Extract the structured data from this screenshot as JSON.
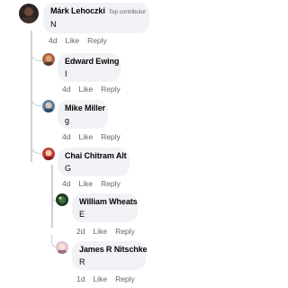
{
  "comments": [
    {
      "author": "Márk Lehoczki",
      "badge": "Top contributor",
      "text": "N",
      "time": "4d",
      "like": "Like",
      "reply": "Reply"
    },
    {
      "author": "Edward Ewing",
      "text": "I",
      "time": "4d",
      "like": "Like",
      "reply": "Reply"
    },
    {
      "author": "Mike Miller",
      "text": "g",
      "time": "4d",
      "like": "Like",
      "reply": "Reply"
    },
    {
      "author": "Chai Chitram Alt",
      "text": "G",
      "time": "4d",
      "like": "Like",
      "reply": "Reply"
    },
    {
      "author": "William Wheats",
      "text": "E",
      "time": "2d",
      "like": "Like",
      "reply": "Reply"
    },
    {
      "author": "James R Nitschke",
      "text": "R",
      "time": "1d",
      "like": "Like",
      "reply": "Reply"
    }
  ]
}
